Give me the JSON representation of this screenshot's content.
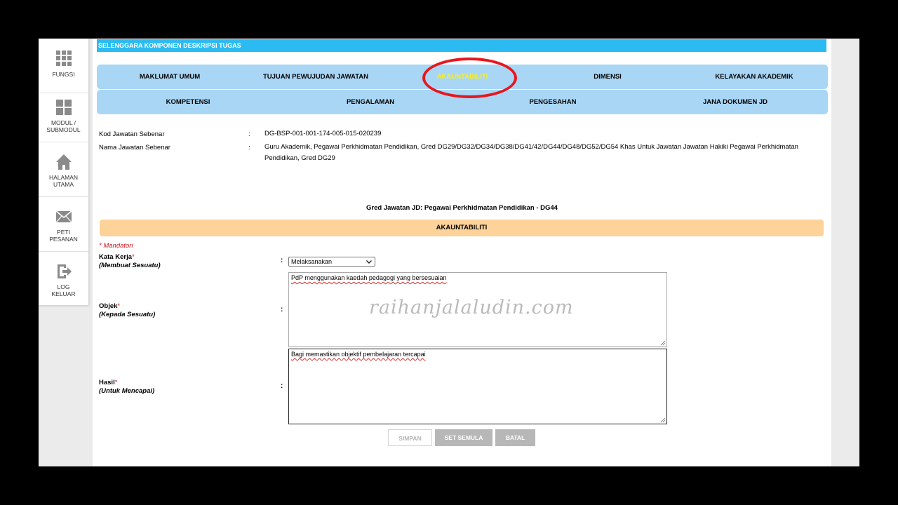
{
  "sidebar": {
    "items": [
      {
        "icon": "grid-icon",
        "label_line1": "FUNGSI",
        "label_line2": ""
      },
      {
        "icon": "modules-icon",
        "label_line1": "MODUL /",
        "label_line2": "SUBMODUL"
      },
      {
        "icon": "home-icon",
        "label_line1": "HALAMAN",
        "label_line2": "UTAMA"
      },
      {
        "icon": "envelope-icon",
        "label_line1": "PETI",
        "label_line2": "PESANAN"
      },
      {
        "icon": "logout-icon",
        "label_line1": "LOG",
        "label_line2": "KELUAR"
      }
    ]
  },
  "header": {
    "title": "SELENGGARA KOMPONEN DESKRIPSI TUGAS"
  },
  "tabs_row1": [
    "MAKLUMAT UMUM",
    "TUJUAN PEWUJUDAN JAWATAN",
    "AKAUNTABILITI",
    "DIMENSI",
    "KELAYAKAN AKADEMIK"
  ],
  "tabs_row2": [
    "KOMPETENSI",
    "PENGALAMAN",
    "PENGESAHAN",
    "JANA DOKUMEN JD"
  ],
  "active_tab": "AKAUNTABILITI",
  "info": {
    "kod_label": "Kod Jawatan Sebenar",
    "kod_value": "DG-BSP-001-001-174-005-015-020239",
    "nama_label": "Nama Jawatan Sebenar",
    "nama_value": "Guru Akademik, Pegawai Perkhidmatan Pendidikan, Gred DG29/DG32/DG34/DG38/DG41/42/DG44/DG48/DG52/DG54 Khas Untuk Jawatan Jawatan Hakiki Pegawai Perkhidmatan Pendidikan, Gred DG29",
    "colon": ":"
  },
  "gred_line": "Gred Jawatan JD: Pegawai Perkhidmatan Pendidikan - DG44",
  "section_title": "AKAUNTABILITI",
  "mandatori": "* Mandatori",
  "form": {
    "kata_kerja_label": "Kata Kerja",
    "kata_kerja_sub": "(Membuat Sesuatu)",
    "kata_kerja_value": "Melaksanakan",
    "objek_label": "Objek",
    "objek_sub": "(Kepada Sesuatu)",
    "objek_value": "PdP menggunakan kaedah pedagogi yang bersesuaian",
    "hasil_label": "Hasil",
    "hasil_sub": "(Untuk Mencapai)",
    "hasil_value": "Bagi memastikan objektif pembelajaran tercapai",
    "required_mark": "*",
    "colon": ":"
  },
  "watermark": "raihanjalaludin.com",
  "buttons": {
    "simpan": "SIMPAN",
    "set_semula": "SET SEMULA",
    "batal": "BATAL"
  },
  "colors": {
    "header": "#2bbbf2",
    "tabs": "#a9d6f5",
    "active_tab": "#f7ef22",
    "section": "#fdd39a",
    "highlight_ring": "#e8171d",
    "required": "#c8171d"
  }
}
